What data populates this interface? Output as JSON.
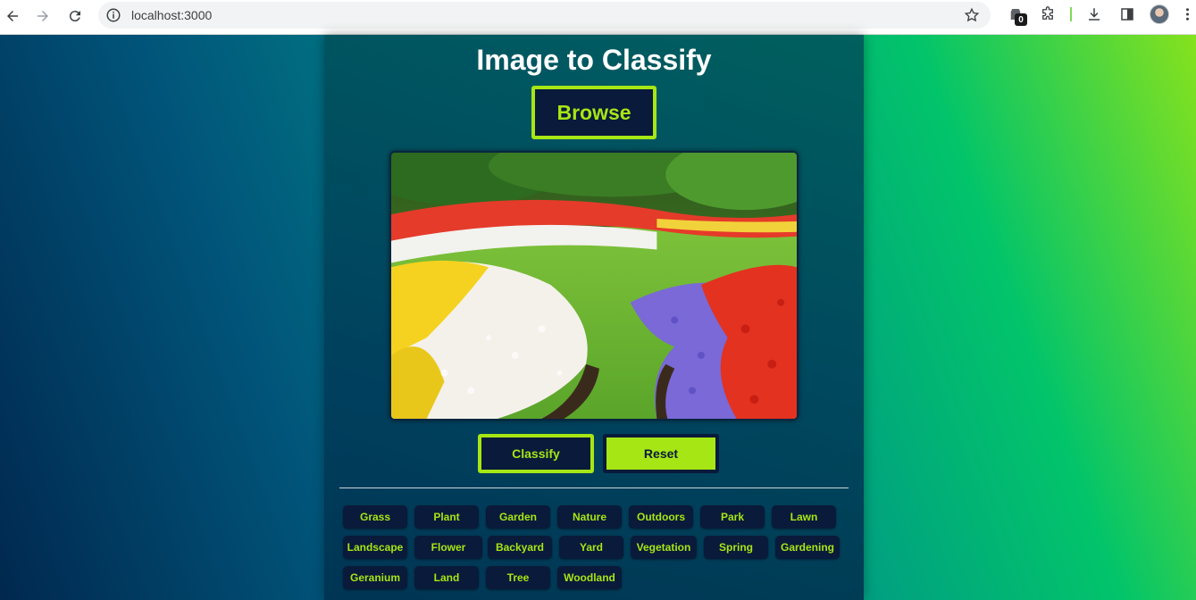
{
  "browser": {
    "url": "localhost:3000",
    "extension_badge": "0"
  },
  "app": {
    "title": "Image to Classify",
    "browse_label": "Browse",
    "classify_label": "Classify",
    "reset_label": "Reset",
    "tags": [
      "Grass",
      "Plant",
      "Garden",
      "Nature",
      "Outdoors",
      "Park",
      "Lawn",
      "Landscape",
      "Flower",
      "Backyard",
      "Yard",
      "Vegetation",
      "Spring",
      "Gardening",
      "Geranium",
      "Land",
      "Tree",
      "Woodland"
    ]
  },
  "colors": {
    "accent": "#a6e614",
    "button_dark": "#091a3a"
  }
}
